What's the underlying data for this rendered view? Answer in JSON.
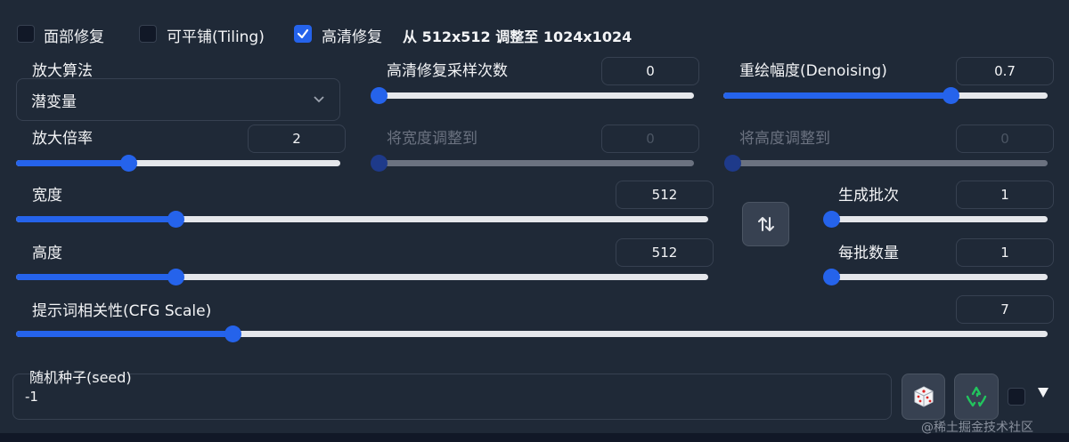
{
  "checkboxes": {
    "face_restore": {
      "label": "面部修复",
      "checked": false
    },
    "tiling": {
      "label": "可平铺(Tiling)",
      "checked": false
    },
    "hires_fix": {
      "label": "高清修复",
      "checked": true
    }
  },
  "hires_info": "从 512x512 调整至 1024x1024",
  "upscaler": {
    "label": "放大算法",
    "value": "潜变量"
  },
  "hires_steps": {
    "label": "高清修复采样次数",
    "value": "0",
    "fraction": 0.0
  },
  "denoising": {
    "label": "重绘幅度(Denoising)",
    "value": "0.7",
    "fraction": 0.7
  },
  "upscale_by": {
    "label": "放大倍率",
    "value": "2",
    "fraction": 0.345
  },
  "resize_width_to": {
    "label": "将宽度调整到",
    "value": "0",
    "fraction": 0.0
  },
  "resize_height_to": {
    "label": "将高度调整到",
    "value": "0",
    "fraction": 0.0
  },
  "width": {
    "label": "宽度",
    "value": "512",
    "fraction": 0.23
  },
  "height": {
    "label": "高度",
    "value": "512",
    "fraction": 0.23
  },
  "batch_count": {
    "label": "生成批次",
    "value": "1",
    "fraction": 0.0
  },
  "batch_size": {
    "label": "每批数量",
    "value": "1",
    "fraction": 0.0
  },
  "cfg_scale": {
    "label": "提示词相关性(CFG Scale)",
    "value": "7",
    "fraction": 0.21
  },
  "seed": {
    "label": "随机种子(seed)",
    "value": "-1"
  },
  "icons": {
    "swap": "swap-arrows-icon",
    "dice": "dice-icon",
    "recycle": "recycle-icon",
    "extra": "triangle-down-icon"
  },
  "watermark": "@稀土掘金技术社区",
  "colors": {
    "accent": "#2563eb",
    "background": "#1f2937",
    "panel": "#111827"
  }
}
